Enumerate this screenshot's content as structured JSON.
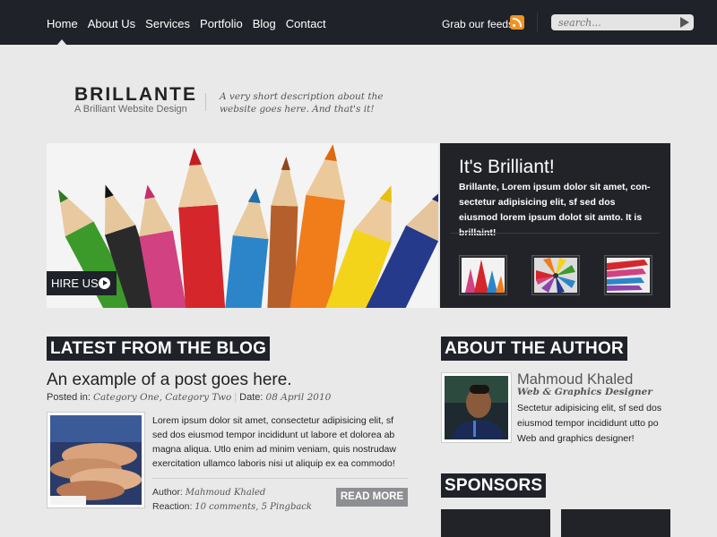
{
  "nav": {
    "items": [
      "Home",
      "About Us",
      "Services",
      "Portfolio",
      "Blog",
      "Contact"
    ],
    "feeds_label": "Grab our feeds",
    "search_placeholder": "search..."
  },
  "header": {
    "site_name": "BRILLANTE",
    "tagline": "A Brilliant Website Design",
    "description": "A very short description about the website goes here. And that's it!"
  },
  "hero": {
    "button_label": "HIRE US",
    "panel_title": "It's Brilliant!",
    "panel_text": "Brillante, Lorem ipsum dolor sit amet, con-sectetur adipisicing elit, sf sed dos eiusmod lorem ipsum dolot sit amto. It is brillaint!"
  },
  "blog": {
    "heading": "LATEST FROM THE BLOG",
    "post": {
      "title": "An example of a post goes here.",
      "posted_label": "Posted in:",
      "categories": "Category One, Category Two",
      "date_label": "Date:",
      "date": "08 April 2010",
      "excerpt": "Lorem ipsum dolor sit amet, consectetur adipisicing elit, sf sed dos eiusmod tempor incididunt ut labore et dolorea ab magna aliqua. Utlo enim ad minim veniam, quis nostrudaw exercitation ullamco laboris nisi ut aliquip ex ea commodo!",
      "author_label": "Author:",
      "author": "Mahmoud Khaled",
      "reaction_label": "Reaction:",
      "reaction": "10 comments, 5 Pingback",
      "read_more": "READ MORE"
    }
  },
  "author": {
    "heading": "ABOUT THE AUTHOR",
    "name": "Mahmoud Khaled",
    "role": "Web & Graphics Designer",
    "bio": "Sectetur adipisicing elit, sf sed dos eiusmod tempor incididunt utto po Web and graphics designer!"
  },
  "sponsors": {
    "heading": "SPONSORS"
  },
  "colors": {
    "nav_bg": "#1f2229",
    "page_bg": "#e9e9ea",
    "rss": "#f39325",
    "read_more_bg": "#8e8f92"
  }
}
